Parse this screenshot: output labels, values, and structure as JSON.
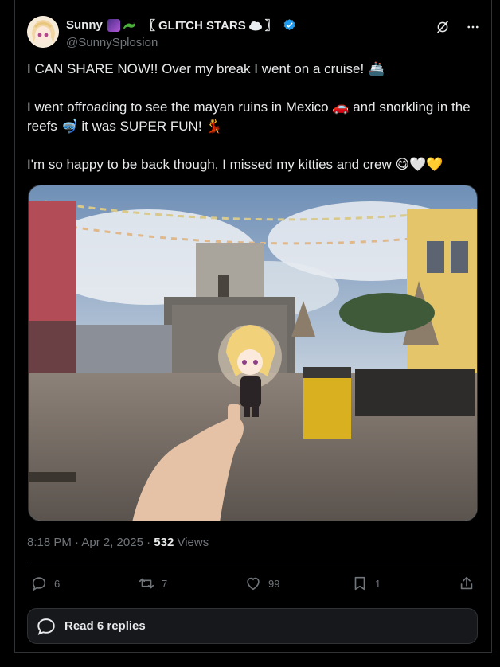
{
  "author": {
    "display_name": "Sunny",
    "team_tag": "〖 GLITCH STARS",
    "team_tag_end": "〗",
    "handle": "@SunnySplosion"
  },
  "tweet": {
    "lines": [
      "I CAN SHARE NOW!! Over my break I went on a cruise! 🚢",
      "I went offroading to see the mayan ruins in Mexico 🚗 and snorkling in the reefs 🤿 it was SUPER FUN! 💃",
      "I'm so happy to be back though, I missed my kitties and crew 😋🤍💛"
    ]
  },
  "meta": {
    "time": "8:18 PM · Apr 2, 2025 · ",
    "views_count": "532",
    "views_label": " Views"
  },
  "actions": {
    "replies": "6",
    "reposts": "7",
    "likes": "99",
    "bookmarks": "1"
  },
  "read_replies_label": "Read 6 replies",
  "colors": {
    "background": "#000000",
    "text": "#e7e9ea",
    "muted": "#71767b",
    "border": "#2f3336",
    "verified": "#1d9bf0"
  },
  "icons": [
    "grok-icon",
    "more-icon",
    "reply-icon",
    "repost-icon",
    "like-icon",
    "bookmark-icon",
    "share-icon",
    "verified-badge-icon",
    "chat-bubble-icon"
  ]
}
